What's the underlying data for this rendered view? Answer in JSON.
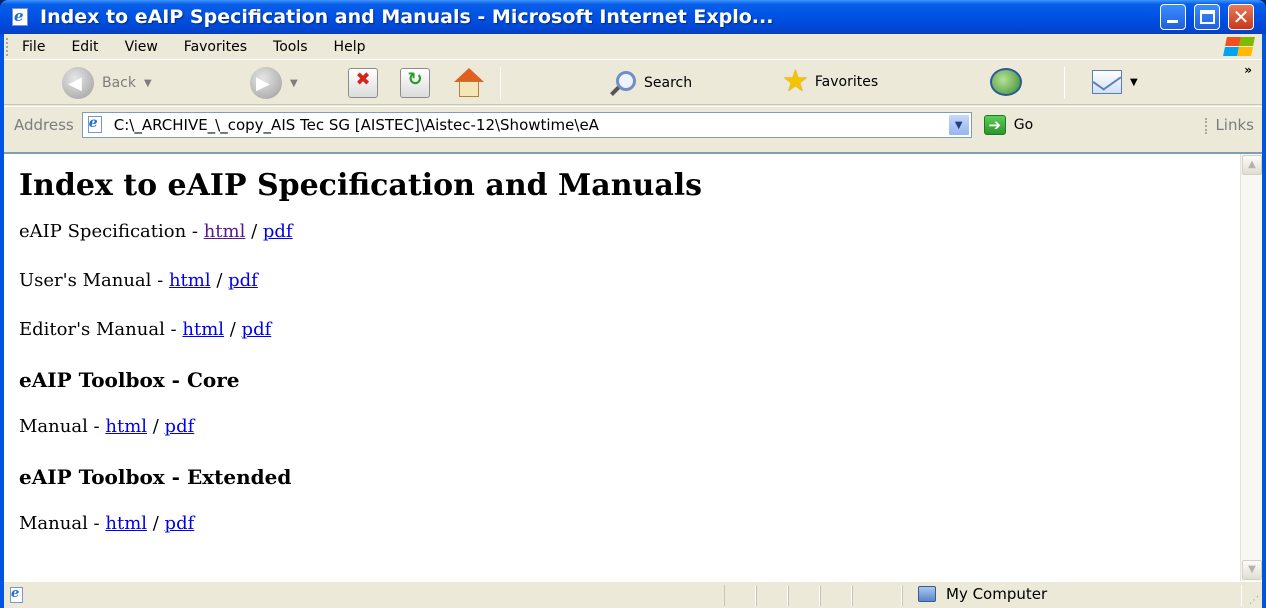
{
  "window": {
    "title": "Index to eAIP Specification and Manuals - Microsoft Internet Explo..."
  },
  "menu": [
    "File",
    "Edit",
    "View",
    "Favorites",
    "Tools",
    "Help"
  ],
  "toolbar": {
    "back_label": "Back",
    "search_label": "Search",
    "favorites_label": "Favorites",
    "overflow": "»"
  },
  "address": {
    "label": "Address",
    "value": "C:\\_ARCHIVE_\\_copy_AIS Tec SG [AISTEC]\\Aistec-12\\Showtime\\eA",
    "go_label": "Go",
    "links_label": "Links"
  },
  "document": {
    "title": "Index to eAIP Specification and Manuals",
    "spec": {
      "label": "eAIP Specification - ",
      "html": "html",
      "sep": " / ",
      "pdf": "pdf"
    },
    "users": {
      "label": "User's Manual - ",
      "html": "html",
      "sep": " / ",
      "pdf": "pdf"
    },
    "editors": {
      "label": "Editor's Manual - ",
      "html": "html",
      "sep": " / ",
      "pdf": "pdf"
    },
    "core_heading": "eAIP Toolbox - Core",
    "core_manual": {
      "label": "Manual - ",
      "html": "html",
      "sep": " / ",
      "pdf": "pdf"
    },
    "extended_heading": "eAIP Toolbox - Extended",
    "extended_manual": {
      "label": "Manual - ",
      "html": "html",
      "sep": " / ",
      "pdf": "pdf"
    }
  },
  "status": {
    "zone": "My Computer"
  },
  "colors": {
    "titlebar": "#0055e5",
    "chrome": "#ece9d8",
    "link": "#0000ee",
    "visited_link": "#551a8b"
  }
}
